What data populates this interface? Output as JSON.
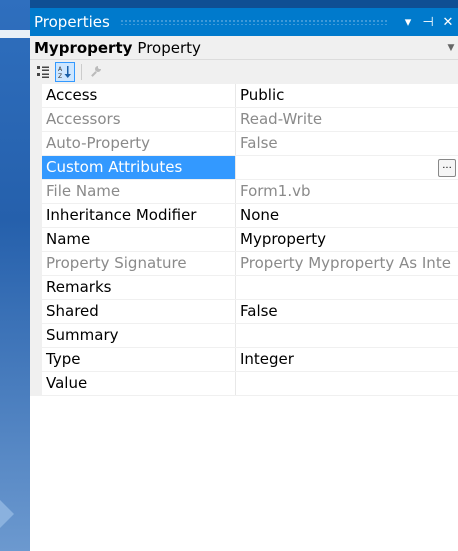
{
  "panel": {
    "title": "Properties",
    "window_buttons": {
      "dropdown": "▾",
      "pin": "⊣",
      "close": "✕"
    }
  },
  "object": {
    "name": "Myproperty",
    "type": "Property"
  },
  "toolbar": {
    "categorized_icon": "categorized-icon",
    "alphabetical_icon": "alphabetical-icon",
    "property_pages_icon": "wrench-icon"
  },
  "properties": [
    {
      "name": "Access",
      "value": "Public",
      "readonly": false
    },
    {
      "name": "Accessors",
      "value": "Read-Write",
      "readonly": true
    },
    {
      "name": "Auto-Property",
      "value": "False",
      "readonly": true
    },
    {
      "name": "Custom Attributes",
      "value": "",
      "readonly": false,
      "selected": true,
      "has_ellipsis": true,
      "ellipsis": "..."
    },
    {
      "name": "File Name",
      "value": "Form1.vb",
      "readonly": true
    },
    {
      "name": "Inheritance Modifier",
      "value": "None",
      "readonly": false
    },
    {
      "name": "Name",
      "value": "Myproperty",
      "readonly": false
    },
    {
      "name": "Property Signature",
      "value": "Property Myproperty As Inte",
      "readonly": true
    },
    {
      "name": "Remarks",
      "value": "",
      "readonly": false
    },
    {
      "name": "Shared",
      "value": "False",
      "readonly": false
    },
    {
      "name": "Summary",
      "value": "",
      "readonly": false
    },
    {
      "name": "Type",
      "value": "Integer",
      "readonly": false
    },
    {
      "name": "Value",
      "value": "",
      "readonly": false
    }
  ],
  "colors": {
    "title_bar": "#007acc",
    "selection": "#3399ff",
    "readonly_text": "#8a8a8a"
  }
}
